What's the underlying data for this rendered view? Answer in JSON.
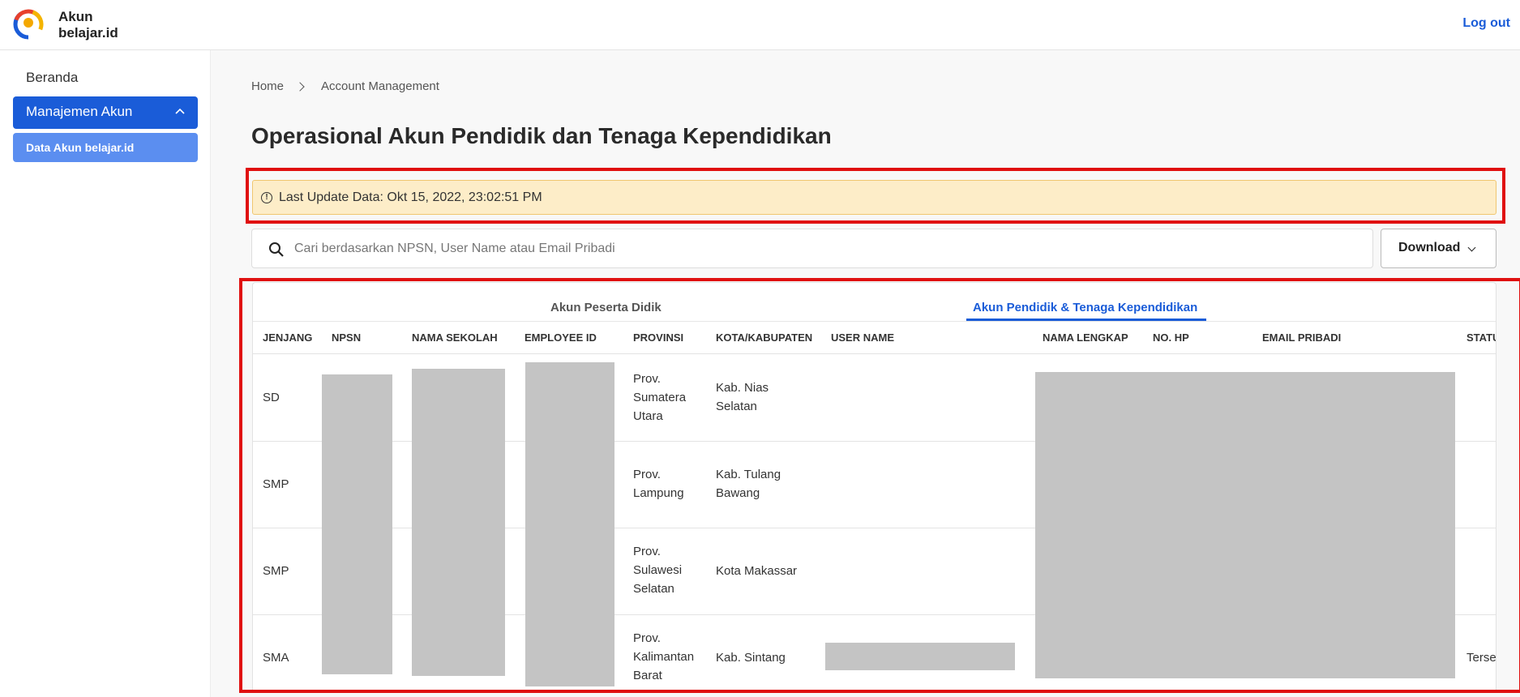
{
  "header": {
    "brand_line1": "Akun",
    "brand_line2": "belajar.id",
    "logout": "Log out"
  },
  "sidebar": {
    "home": "Beranda",
    "menu": "Manajemen Akun",
    "submenu": "Data Akun belajar.id"
  },
  "breadcrumb": {
    "home": "Home",
    "current": "Account Management"
  },
  "page_title": "Operasional Akun Pendidik dan Tenaga Kependidikan",
  "notice": "Last Update Data: Okt 15, 2022, 23:02:51 PM",
  "search": {
    "placeholder": "Cari berdasarkan NPSN, User Name atau Email Pribadi"
  },
  "download": "Download",
  "tabs": [
    "Akun Peserta Didik",
    "Akun Pendidik & Tenaga Kependidikan"
  ],
  "active_tab": 1,
  "table": {
    "columns": [
      "JENJANG",
      "NPSN",
      "NAMA SEKOLAH",
      "EMPLOYEE ID",
      "PROVINSI",
      "KOTA/KABUPATEN",
      "USER NAME",
      "NAMA LENGKAP",
      "NO. HP",
      "EMAIL PRIBADI",
      "STATU"
    ],
    "rows": [
      {
        "jenjang": "SD",
        "provinsi": [
          "Prov.",
          "Sumatera",
          "Utara"
        ],
        "kota": [
          "Kab. Nias",
          "Selatan"
        ],
        "status": ""
      },
      {
        "jenjang": "SMP",
        "provinsi": [
          "Prov.",
          "Lampung"
        ],
        "kota": [
          "Kab. Tulang",
          "Bawang"
        ],
        "status": ""
      },
      {
        "jenjang": "SMP",
        "provinsi": [
          "Prov.",
          "Sulawesi",
          "Selatan"
        ],
        "kota": [
          "Kota Makassar"
        ],
        "status": ""
      },
      {
        "jenjang": "SMA",
        "provinsi": [
          "Prov.",
          "Kalimantan",
          "Barat"
        ],
        "kota": [
          "Kab. Sintang"
        ],
        "status": "Terse"
      }
    ]
  },
  "colors": {
    "accent": "#1a5cd8",
    "submenu": "#5b8ef0",
    "notice_bg": "#fdedc8",
    "highlight_border": "#e01010",
    "redaction": "#c4c4c4"
  }
}
